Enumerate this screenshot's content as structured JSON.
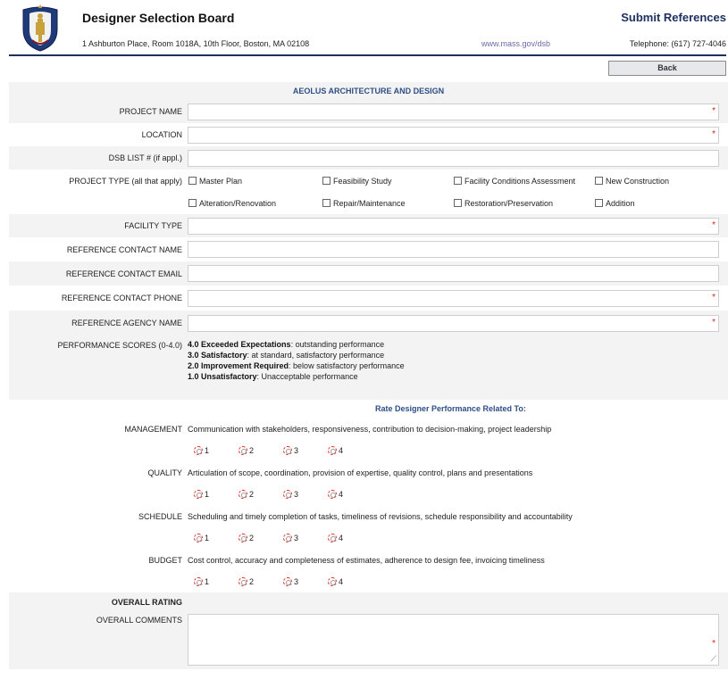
{
  "header": {
    "org_title": "Designer Selection Board",
    "address": "1 Ashburton Place, Room 1018A, 10th Floor, Boston, MA 02108",
    "website": "www.mass.gov/dsb",
    "page_title": "Submit References",
    "telephone": "Telephone: (617) 727-4046"
  },
  "back_label": "Back",
  "firm_name": "AEOLUS ARCHITECTURE AND DESIGN",
  "fields": {
    "project_name": "PROJECT NAME",
    "location": "LOCATION",
    "dsb_list": "DSB LIST # (if appl.)",
    "project_type": "PROJECT TYPE (all that apply)",
    "facility_type": "FACILITY TYPE",
    "contact_name": "REFERENCE CONTACT NAME",
    "contact_email": "REFERENCE CONTACT EMAIL",
    "contact_phone": "REFERENCE CONTACT PHONE",
    "agency_name": "REFERENCE AGENCY NAME",
    "performance": "PERFORMANCE SCORES (0-4.0)"
  },
  "project_types": [
    "Master Plan",
    "Feasibility Study",
    "Facility Conditions Assessment",
    "New Construction",
    "Alteration/Renovation",
    "Repair/Maintenance",
    "Restoration/Preservation",
    "Addition"
  ],
  "required_mark": "*",
  "scores": [
    {
      "score": "4.0 Exceeded Expectations",
      "desc": ": outstanding performance"
    },
    {
      "score": "3.0 Satisfactory",
      "desc": ": at standard, satisfactory performance"
    },
    {
      "score": "2.0 Improvement Required",
      "desc": ": below satisfactory performance"
    },
    {
      "score": "1.0 Unsatisfactory",
      "desc": ": Unacceptable performance"
    }
  ],
  "rate_header": "Rate Designer Performance Related To:",
  "criteria": [
    {
      "label": "MANAGEMENT",
      "desc": "Communication with stakeholders, responsiveness, contribution to decision-making, project leadership"
    },
    {
      "label": "QUALITY",
      "desc": "Articulation of scope, coordination, provision of expertise, quality control, plans and presentations"
    },
    {
      "label": "SCHEDULE",
      "desc": "Scheduling and timely completion of tasks, timeliness of revisions, schedule responsibility and accountability"
    },
    {
      "label": "BUDGET",
      "desc": "Cost control, accuracy and completeness of estimates, adherence to design fee, invoicing timeliness"
    }
  ],
  "rating_options": [
    "1",
    "2",
    "3",
    "4"
  ],
  "overall_rating": "OVERALL RATING",
  "overall_comments": "OVERALL COMMENTS",
  "colors": {
    "navy": "#1d3060",
    "link": "#2e4e86",
    "required": "#e0201c"
  },
  "icons": {
    "seal": "massachusetts-seal-icon",
    "resize": "resize-grip-icon"
  }
}
